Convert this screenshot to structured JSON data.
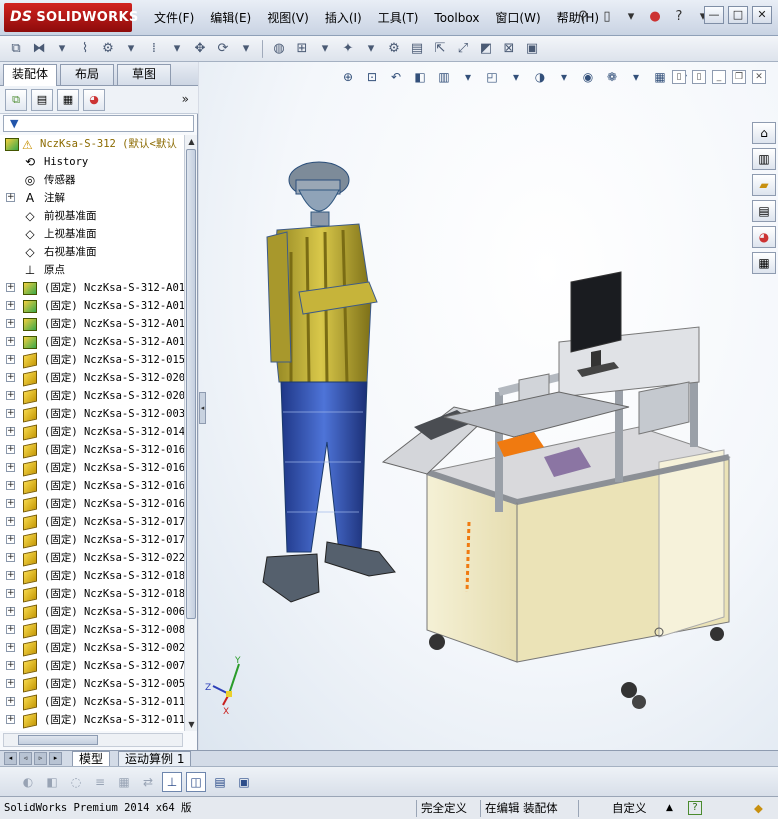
{
  "app": {
    "logo_ds": "DS",
    "logo_text": "SOLIDWORKS",
    "menus": [
      "文件(F)",
      "编辑(E)",
      "视图(V)",
      "插入(I)",
      "工具(T)",
      "Toolbox",
      "窗口(W)",
      "帮助(H)"
    ],
    "window_controls": [
      "—",
      "□",
      "✕"
    ],
    "help_label": "?"
  },
  "left_panel": {
    "tabs": [
      "装配体",
      "布局",
      "草图"
    ],
    "active_tab": "装配体",
    "chevron": "»",
    "filter_label": "▼",
    "root": "NczKsa-S-312 (默认<默认",
    "feature_nodes": [
      {
        "label": "History",
        "icon": "history-icon"
      },
      {
        "label": "传感器",
        "icon": "sensor-icon"
      },
      {
        "label": "注解",
        "icon": "annotation-icon",
        "expandable": true
      },
      {
        "label": "前视基准面",
        "icon": "plane-icon"
      },
      {
        "label": "上视基准面",
        "icon": "plane-icon"
      },
      {
        "label": "右视基准面",
        "icon": "plane-icon"
      },
      {
        "label": "原点",
        "icon": "origin-icon"
      }
    ],
    "components": [
      {
        "label": "(固定) NczKsa-S-312-A01",
        "kind": "asm"
      },
      {
        "label": "(固定) NczKsa-S-312-A01",
        "kind": "asm"
      },
      {
        "label": "(固定) NczKsa-S-312-A01",
        "kind": "asm"
      },
      {
        "label": "(固定) NczKsa-S-312-A01",
        "kind": "asm"
      },
      {
        "label": "(固定) NczKsa-S-312-015",
        "kind": "part"
      },
      {
        "label": "(固定) NczKsa-S-312-020",
        "kind": "part"
      },
      {
        "label": "(固定) NczKsa-S-312-020",
        "kind": "part"
      },
      {
        "label": "(固定) NczKsa-S-312-003",
        "kind": "part"
      },
      {
        "label": "(固定) NczKsa-S-312-014",
        "kind": "part"
      },
      {
        "label": "(固定) NczKsa-S-312-016",
        "kind": "part"
      },
      {
        "label": "(固定) NczKsa-S-312-016",
        "kind": "part"
      },
      {
        "label": "(固定) NczKsa-S-312-016",
        "kind": "part"
      },
      {
        "label": "(固定) NczKsa-S-312-016",
        "kind": "part"
      },
      {
        "label": "(固定) NczKsa-S-312-017",
        "kind": "part"
      },
      {
        "label": "(固定) NczKsa-S-312-017",
        "kind": "part"
      },
      {
        "label": "(固定) NczKsa-S-312-022",
        "kind": "part"
      },
      {
        "label": "(固定) NczKsa-S-312-018",
        "kind": "part"
      },
      {
        "label": "(固定) NczKsa-S-312-018",
        "kind": "part"
      },
      {
        "label": "(固定) NczKsa-S-312-006",
        "kind": "part"
      },
      {
        "label": "(固定) NczKsa-S-312-008",
        "kind": "part"
      },
      {
        "label": "(固定) NczKsa-S-312-002",
        "kind": "part"
      },
      {
        "label": "(固定) NczKsa-S-312-007",
        "kind": "part"
      },
      {
        "label": "(固定) NczKsa-S-312-005",
        "kind": "part"
      },
      {
        "label": "(固定) NczKsa-S-312-011",
        "kind": "part"
      },
      {
        "label": "(固定) NczKsa-S-312-011",
        "kind": "part"
      }
    ]
  },
  "graphics": {
    "triad": {
      "x": "X",
      "y": "Y",
      "z": "Z"
    },
    "colors": {
      "cabinet": "#f0ebc8",
      "frame": "#c9ccd1",
      "worker_shirt": "#b9a52a",
      "worker_pants": "#2f4fb5",
      "accent_orange": "#f07a10"
    }
  },
  "bottom_tabs": [
    "模型",
    "运动算例 1"
  ],
  "status": {
    "product": "SolidWorks Premium 2014 x64 版",
    "constraint": "完全定义",
    "mode": "在编辑 装配体",
    "units": "自定义"
  }
}
